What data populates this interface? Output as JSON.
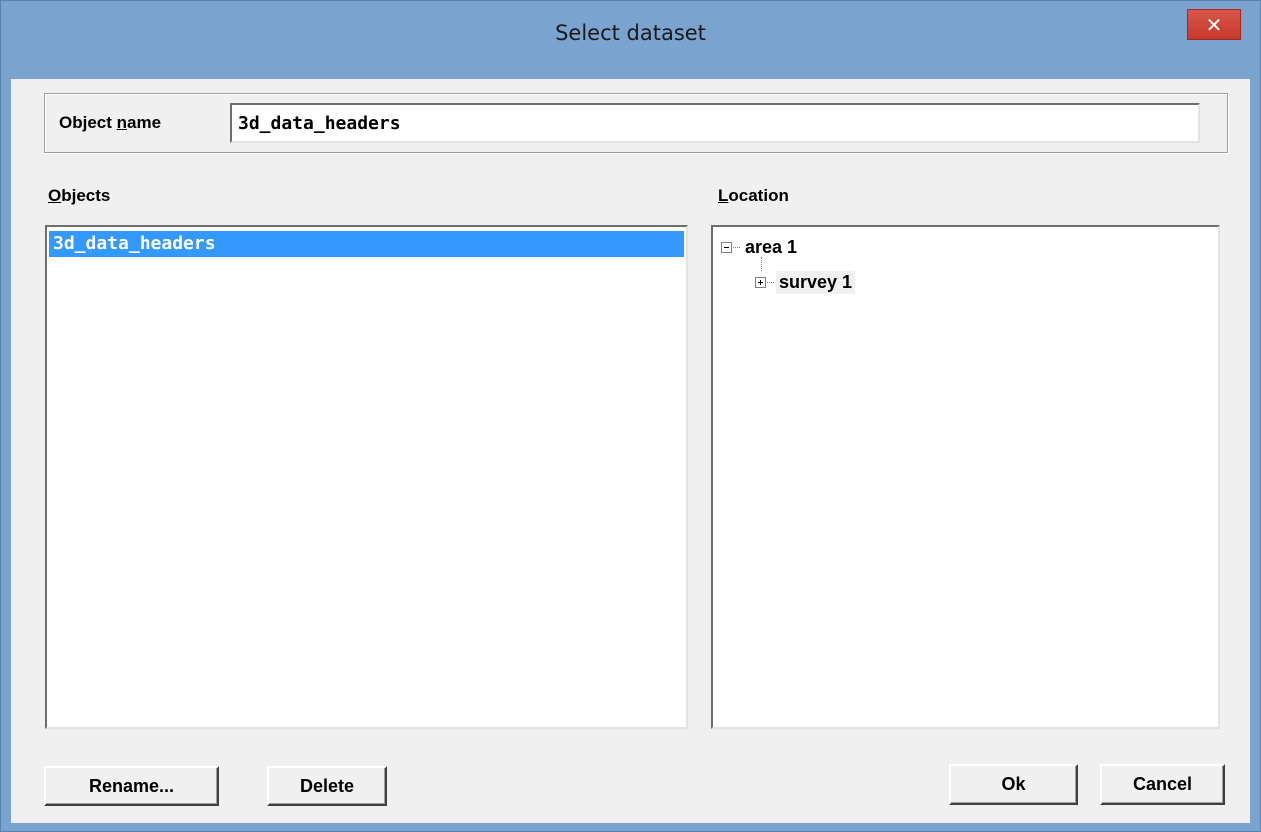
{
  "window": {
    "title": "Select dataset",
    "close_glyph": "✕"
  },
  "object_name": {
    "label_prefix": "Object ",
    "label_mnemonic": "n",
    "label_suffix": "ame",
    "value": "3d_data_headers"
  },
  "objects": {
    "label_mnemonic": "O",
    "label_suffix": "bjects",
    "items": [
      {
        "label": "3d_data_headers",
        "selected": true
      }
    ]
  },
  "location": {
    "label_mnemonic": "L",
    "label_suffix": "ocation",
    "tree": [
      {
        "label": "area 1",
        "expanded": true
      },
      {
        "label": "survey 1",
        "expanded": false
      }
    ]
  },
  "buttons": {
    "rename": "Rename...",
    "delete": "Delete",
    "ok": "Ok",
    "cancel": "Cancel"
  },
  "colors": {
    "titlebar": "#7ba3cf",
    "selection": "#3399ff",
    "close_button": "#c7382c",
    "dialog_background": "#f0f0f0"
  },
  "icons": {
    "close": "close-icon",
    "collapse": "minus-box-icon",
    "expand": "plus-box-icon"
  }
}
